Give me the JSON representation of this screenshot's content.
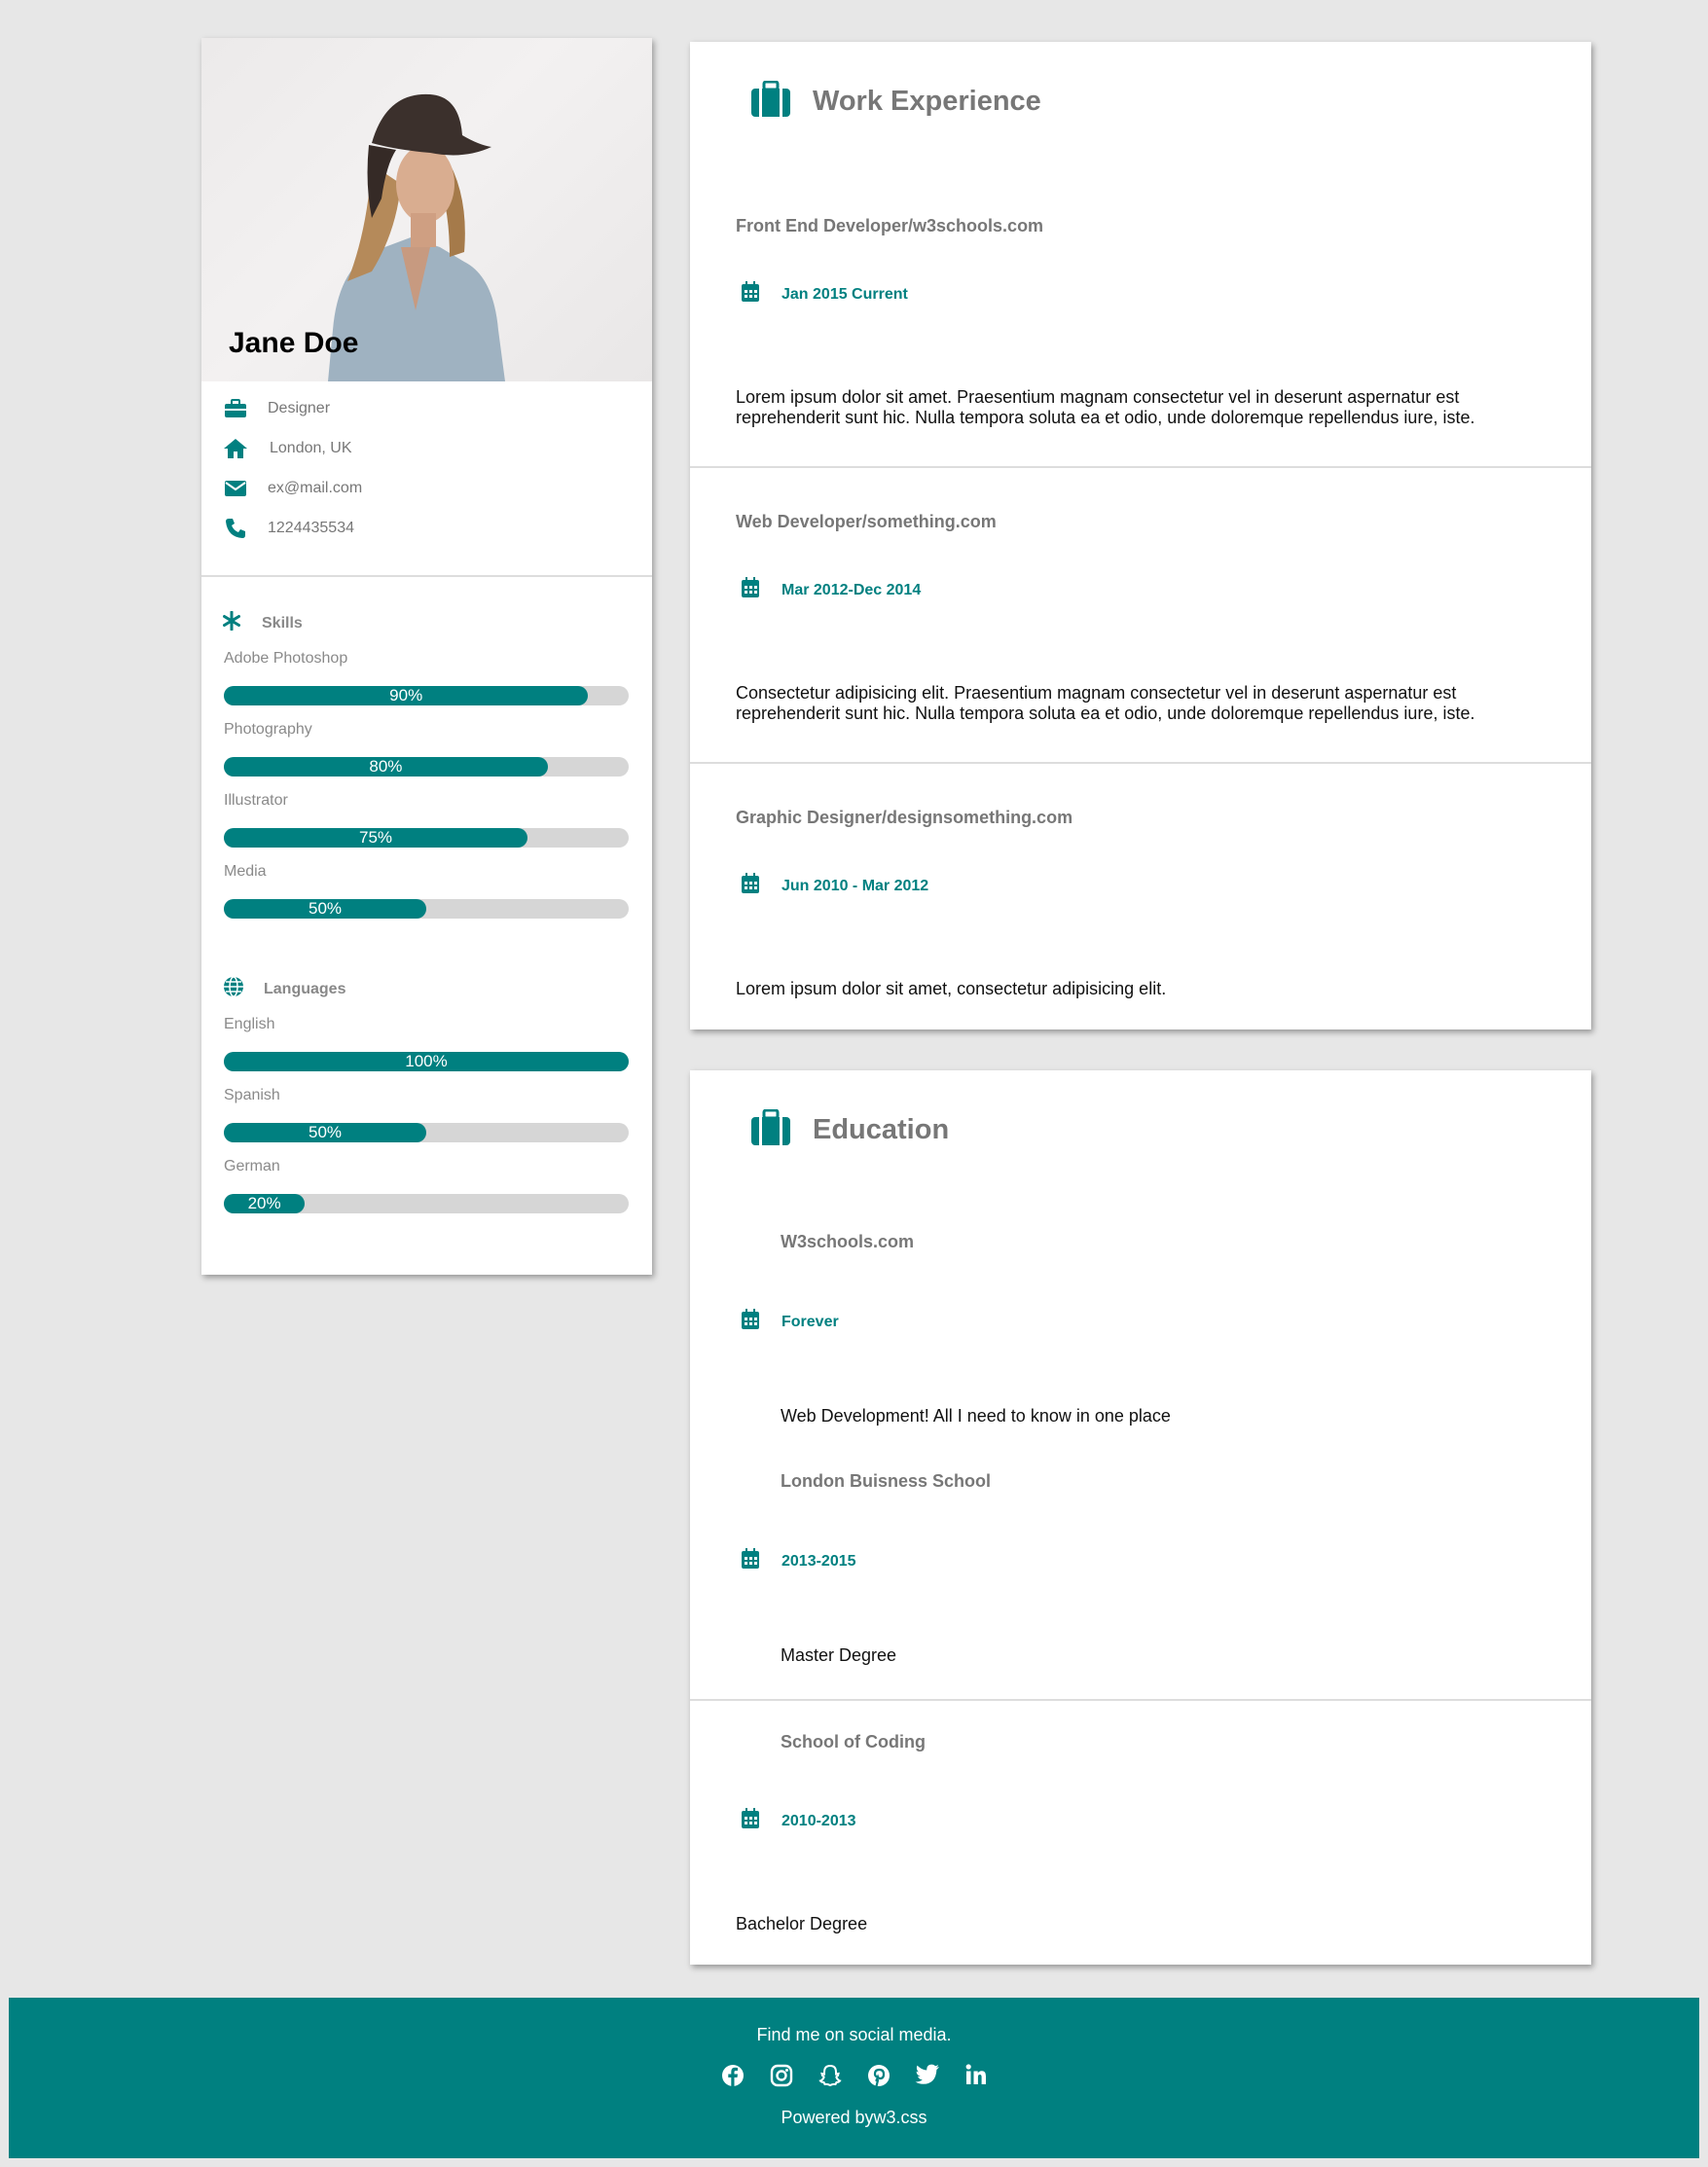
{
  "profile": {
    "name": "Jane Doe",
    "job": "Designer",
    "location": "London, UK",
    "email": "ex@mail.com",
    "phone": "1224435534"
  },
  "skills": {
    "title": "Skills",
    "items": [
      {
        "label": "Adobe Photoshop",
        "percent": 90,
        "text": "90%"
      },
      {
        "label": "Photography",
        "percent": 80,
        "text": "80%"
      },
      {
        "label": "Illustrator",
        "percent": 75,
        "text": "75%"
      },
      {
        "label": "Media",
        "percent": 50,
        "text": "50%"
      }
    ]
  },
  "languages": {
    "title": "Languages",
    "items": [
      {
        "label": "English",
        "percent": 100,
        "text": "100%"
      },
      {
        "label": "Spanish",
        "percent": 50,
        "text": "50%"
      },
      {
        "label": "German",
        "percent": 20,
        "text": "20%"
      }
    ]
  },
  "work": {
    "title": "Work Experience",
    "entries": [
      {
        "title": "Front End Developer/w3schools.com",
        "date": "Jan 2015 Current",
        "desc": "Lorem ipsum dolor sit amet. Praesentium magnam consectetur vel in deserunt aspernatur est reprehenderit sunt hic. Nulla tempora soluta ea et odio, unde doloremque repellendus iure, iste."
      },
      {
        "title": "Web Developer/something.com",
        "date": "Mar 2012-Dec 2014",
        "desc": "Consectetur adipisicing elit. Praesentium magnam consectetur vel in deserunt aspernatur est reprehenderit sunt hic. Nulla tempora soluta ea et odio, unde doloremque repellendus iure, iste."
      },
      {
        "title": "Graphic Designer/designsomething.com",
        "date": "Jun 2010 - Mar 2012",
        "desc": "Lorem ipsum dolor sit amet, consectetur adipisicing elit."
      }
    ]
  },
  "education": {
    "title": "Education",
    "entries": [
      {
        "title": "W3schools.com",
        "date": "Forever",
        "desc": "Web Development! All I need to know in one place"
      },
      {
        "title": "London Buisness School",
        "date": "2013-2015",
        "desc": "Master Degree"
      },
      {
        "title": "School of Coding",
        "date": "2010-2013",
        "desc": "Bachelor Degree"
      }
    ]
  },
  "footer": {
    "find": "Find me on social media.",
    "powered": "Powered byw3.css",
    "social_icons": [
      "facebook-icon",
      "instagram-icon",
      "snapchat-icon",
      "pinterest-icon",
      "twitter-icon",
      "linkedin-icon"
    ]
  },
  "colors": {
    "accent": "#008080",
    "background": "#e7e7e7",
    "bar_track": "#d6d6d6"
  }
}
